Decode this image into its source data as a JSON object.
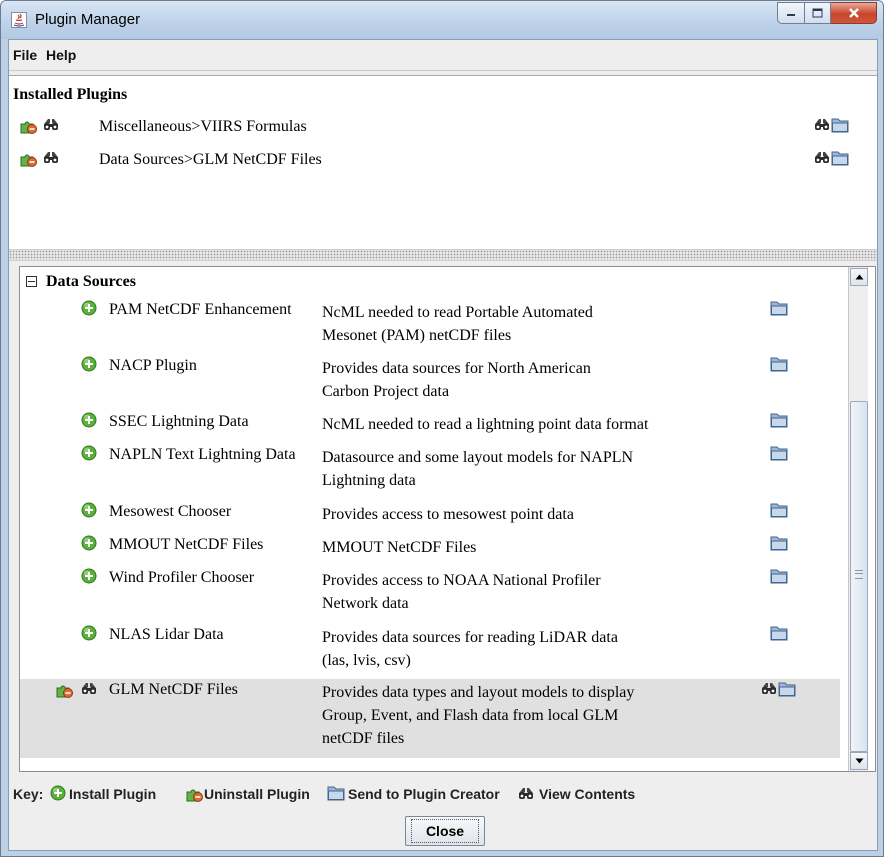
{
  "window": {
    "title": "Plugin Manager"
  },
  "menu": {
    "file": "File",
    "help": "Help"
  },
  "installed": {
    "title": "Installed Plugins",
    "items": [
      {
        "label": "Miscellaneous>VIIRS Formulas"
      },
      {
        "label": "Data Sources>GLM NetCDF Files"
      }
    ]
  },
  "available": {
    "group_label": "Data Sources",
    "plugins": [
      {
        "name": "PAM NetCDF Enhancement",
        "desc": [
          "NcML needed to read Portable Automated",
          "Mesonet (PAM) netCDF files"
        ],
        "installed": false
      },
      {
        "name": "NACP Plugin",
        "desc": [
          "Provides data sources for North American",
          "Carbon Project data"
        ],
        "installed": false
      },
      {
        "name": "SSEC Lightning Data",
        "desc": [
          "NcML needed to read a lightning point data format"
        ],
        "installed": false
      },
      {
        "name": "NAPLN Text Lightning Data",
        "desc": [
          "Datasource and some layout models for NAPLN",
          "Lightning data"
        ],
        "installed": false
      },
      {
        "name": "Mesowest Chooser",
        "desc": [
          "Provides access to mesowest point data"
        ],
        "installed": false
      },
      {
        "name": "MMOUT NetCDF Files",
        "desc": [
          "MMOUT NetCDF Files"
        ],
        "installed": false
      },
      {
        "name": "Wind Profiler Chooser",
        "desc": [
          "Provides access to NOAA National Profiler",
          "Network data"
        ],
        "installed": false
      },
      {
        "name": "NLAS Lidar Data",
        "desc": [
          "Provides data sources for reading LiDAR data",
          "(las, lvis, csv)"
        ],
        "installed": false
      },
      {
        "name": "GLM NetCDF Files",
        "desc": [
          "Provides data types and layout models to display",
          "Group, Event, and Flash data from local GLM",
          "netCDF files"
        ],
        "installed": true
      }
    ]
  },
  "key": {
    "prefix": "Key:",
    "install": "Install Plugin",
    "uninstall": "Uninstall Plugin",
    "send": "Send to Plugin Creator",
    "view": "View Contents"
  },
  "close_label": "Close",
  "icons": {
    "install": "install-plugin-icon",
    "uninstall": "uninstall-plugin-icon",
    "send": "send-to-plugin-creator-icon",
    "view": "view-contents-icon"
  },
  "colors": {
    "title_bar": "#bfd3ea",
    "close_red": "#c7452a",
    "install_green": "#5ab03a",
    "selected_row": "#e0e0e0"
  }
}
